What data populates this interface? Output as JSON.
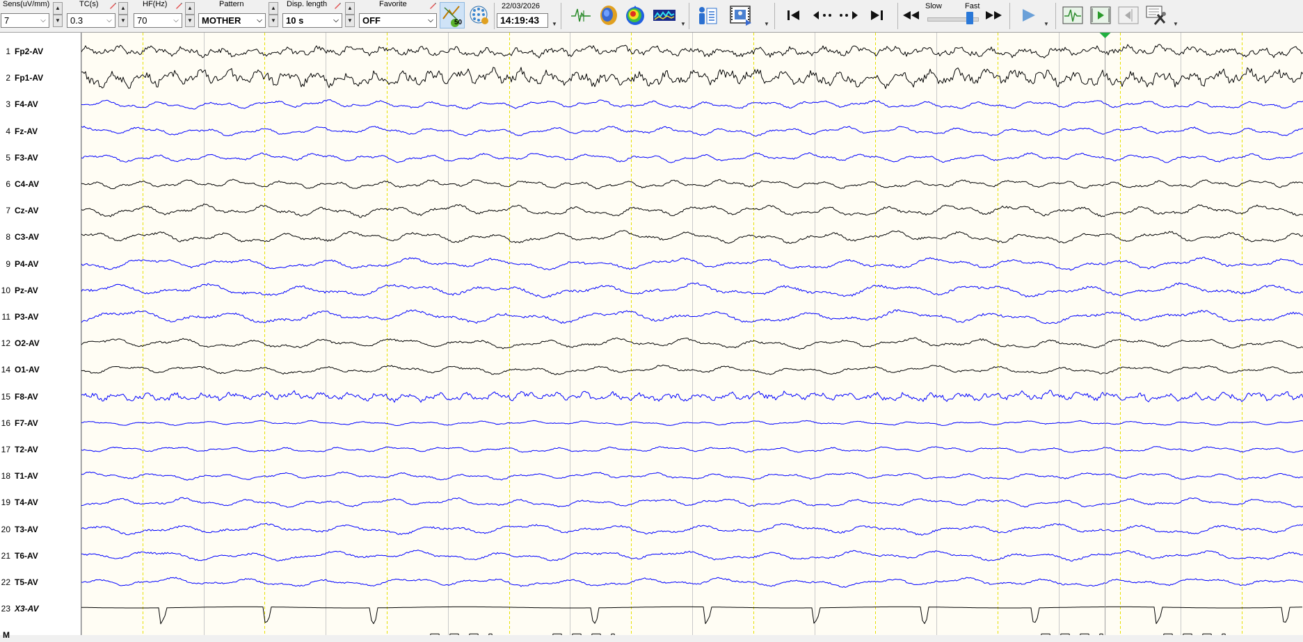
{
  "toolbar": {
    "sens": {
      "label": "Sens(uV/mm)",
      "value": "7"
    },
    "tc": {
      "label": "TC(s)",
      "value": "0.3"
    },
    "hf": {
      "label": "HF(Hz)",
      "value": "70"
    },
    "pattern": {
      "label": "Pattern",
      "value": "MOTHER"
    },
    "disp_length": {
      "label": "Disp. length",
      "value": "10 s"
    },
    "favorite": {
      "label": "Favorite",
      "value": "OFF"
    },
    "notch_badge": "50",
    "date": "22/03/2026",
    "time": "14:19:43",
    "speed": {
      "slow_label": "Slow",
      "fast_label": "Fast"
    },
    "icons": [
      "pencil-icon",
      "notch-filter-icon",
      "electrode-grid-icon",
      "montage-icon",
      "head-map-icon",
      "topography-icon",
      "spectrum-icon",
      "patient-info-icon",
      "video-icon",
      "go-start-icon",
      "step-back-icon",
      "step-forward-icon",
      "go-end-icon",
      "rewind-icon",
      "fast-forward-icon",
      "play-icon",
      "waveform-icon",
      "play-marker-icon",
      "page-back-icon",
      "settings-tools-icon"
    ]
  },
  "channels": [
    {
      "num": "1",
      "name": "Fp2-AV",
      "color": "#000000",
      "amp": 7,
      "freq": 2.6
    },
    {
      "num": "2",
      "name": "Fp1-AV",
      "color": "#000000",
      "amp": 11,
      "freq": 3.0
    },
    {
      "num": "3",
      "name": "F4-AV",
      "color": "#0000ff",
      "amp": 6,
      "freq": 1.6
    },
    {
      "num": "4",
      "name": "Fz-AV",
      "color": "#0000ff",
      "amp": 6,
      "freq": 1.5
    },
    {
      "num": "5",
      "name": "F3-AV",
      "color": "#0000ff",
      "amp": 6,
      "freq": 1.6
    },
    {
      "num": "6",
      "name": "C4-AV",
      "color": "#000000",
      "amp": 6,
      "freq": 1.8
    },
    {
      "num": "7",
      "name": "Cz-AV",
      "color": "#000000",
      "amp": 8,
      "freq": 1.4
    },
    {
      "num": "8",
      "name": "C3-AV",
      "color": "#000000",
      "amp": 8,
      "freq": 1.3
    },
    {
      "num": "9",
      "name": "P4-AV",
      "color": "#0000ff",
      "amp": 8,
      "freq": 1.0
    },
    {
      "num": "10",
      "name": "Pz-AV",
      "color": "#0000ff",
      "amp": 9,
      "freq": 0.9
    },
    {
      "num": "11",
      "name": "P3-AV",
      "color": "#0000ff",
      "amp": 9,
      "freq": 0.9
    },
    {
      "num": "12",
      "name": "O2-AV",
      "color": "#000000",
      "amp": 7,
      "freq": 1.2
    },
    {
      "num": "14",
      "name": "O1-AV",
      "color": "#000000",
      "amp": 6,
      "freq": 1.3
    },
    {
      "num": "15",
      "name": "F8-AV",
      "color": "#0000ff",
      "amp": 6,
      "freq": 3.0
    },
    {
      "num": "16",
      "name": "F7-AV",
      "color": "#0000ff",
      "amp": 3,
      "freq": 1.6
    },
    {
      "num": "17",
      "name": "T2-AV",
      "color": "#0000ff",
      "amp": 4,
      "freq": 1.6
    },
    {
      "num": "18",
      "name": "T1-AV",
      "color": "#0000ff",
      "amp": 5,
      "freq": 1.4
    },
    {
      "num": "19",
      "name": "T4-AV",
      "color": "#0000ff",
      "amp": 6,
      "freq": 1.3
    },
    {
      "num": "20",
      "name": "T3-AV",
      "color": "#0000ff",
      "amp": 7,
      "freq": 1.0
    },
    {
      "num": "21",
      "name": "T6-AV",
      "color": "#0000ff",
      "amp": 7,
      "freq": 1.0
    },
    {
      "num": "22",
      "name": "T5-AV",
      "color": "#0000ff",
      "amp": 6,
      "freq": 1.1
    },
    {
      "num": "23",
      "name": "X3-AV",
      "color": "#000000",
      "amp": 0,
      "freq": 0,
      "italic": true,
      "ecg": true
    },
    {
      "num": "",
      "name": "M",
      "color": "#000000",
      "amp": 0,
      "freq": 0,
      "marker": true
    }
  ],
  "ecg_spike_fractions": [
    0.065,
    0.151,
    0.239,
    0.42,
    0.511,
    0.6,
    0.69,
    0.78,
    0.88,
    0.985
  ],
  "marker_event_fractions": [
    0.285,
    0.385,
    0.785,
    0.885
  ],
  "cursor_fraction": 0.838,
  "grid": {
    "seconds": 10,
    "divisions_per_second": 2,
    "major_color": "#c9c9c9",
    "minor_color": "#e6e000"
  }
}
